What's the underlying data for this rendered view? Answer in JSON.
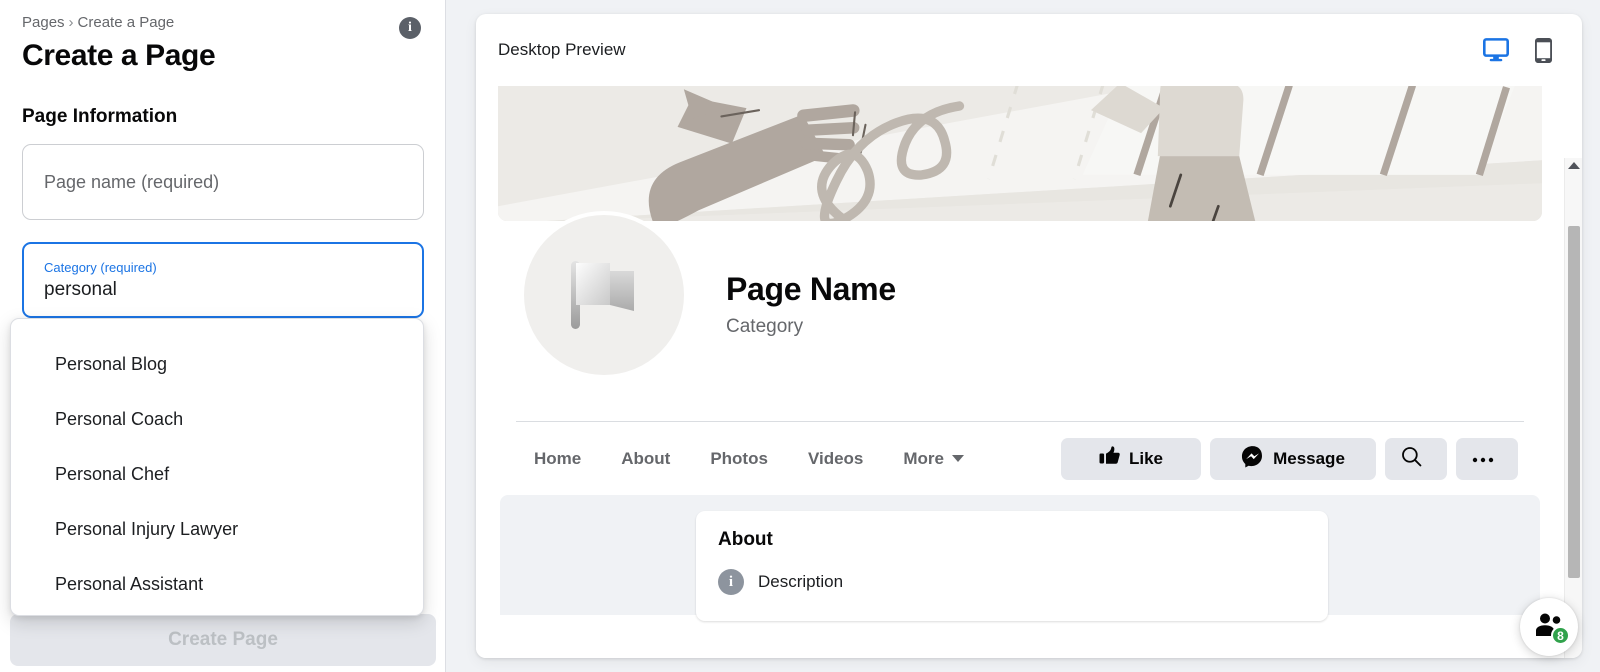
{
  "left": {
    "breadcrumb": {
      "root": "Pages",
      "separator": "›",
      "current": "Create a Page"
    },
    "title": "Create a Page",
    "info_icon_label": "i",
    "section_title": "Page Information",
    "fields": {
      "page_name": {
        "placeholder": "Page name (required)",
        "value": ""
      },
      "category": {
        "label": "Category (required)",
        "value": "personal",
        "placeholder": "Category (required)"
      },
      "obscured": {
        "placeholder": ""
      }
    },
    "dropdown": {
      "options": [
        "Personal Blog",
        "Personal Coach",
        "Personal Chef",
        "Personal Injury Lawyer",
        "Personal Assistant"
      ]
    },
    "submit_label": "Create Page"
  },
  "preview": {
    "header_title": "Desktop Preview",
    "toggles": [
      {
        "name": "desktop-view",
        "active": true,
        "color": "#1b74e4"
      },
      {
        "name": "mobile-view",
        "active": false,
        "color": "#4b4f56"
      }
    ],
    "page": {
      "name": "Page Name",
      "category": "Category",
      "avatar_icon": "flag-icon",
      "tabs": [
        {
          "label": "Home"
        },
        {
          "label": "About"
        },
        {
          "label": "Photos"
        },
        {
          "label": "Videos"
        },
        {
          "label": "More",
          "has_caret": true
        }
      ],
      "actions": [
        {
          "name": "like-button",
          "label": "Like",
          "icon": "thumbs-up-icon"
        },
        {
          "name": "message-button",
          "label": "Message",
          "icon": "messenger-icon"
        },
        {
          "name": "search-button",
          "label": "",
          "icon": "search-icon"
        },
        {
          "name": "more-options-button",
          "label": "",
          "icon": "ellipsis-icon"
        }
      ],
      "about_card": {
        "title": "About",
        "description_label": "Description",
        "info_icon": "i"
      }
    },
    "scrollbar": {
      "arrow": "chevron-up-icon"
    }
  },
  "contacts_fab": {
    "icon": "people-icon",
    "badge": "8",
    "badge_color": "#31a24c"
  },
  "colors": {
    "accent_blue": "#1b74e4",
    "panel_bg": "#f0f2f5",
    "pill_bg": "#e4e6eb",
    "muted_text": "#65676b",
    "disabled_text": "#bcc0c4"
  }
}
